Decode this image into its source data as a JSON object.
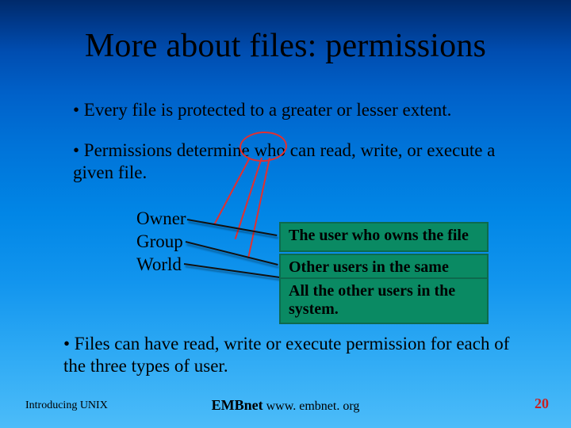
{
  "title": "More about files: permissions",
  "bullets": {
    "b1": "• Every file is protected to a greater or lesser extent.",
    "b2": "• Permissions determine who can read, write, or execute a given file.",
    "b3": "• Files can have read, write or execute permission for each of the three types of user."
  },
  "who_labels": {
    "owner": "Owner",
    "group": "Group",
    "world": "World"
  },
  "callouts": {
    "owner": "The user who owns the file",
    "group": "Other users in the same",
    "world": "All the other users in the system."
  },
  "footer": {
    "left": "Introducing UNIX",
    "brand": "EMBnet",
    "url": "www. embnet. org",
    "page": "20"
  }
}
